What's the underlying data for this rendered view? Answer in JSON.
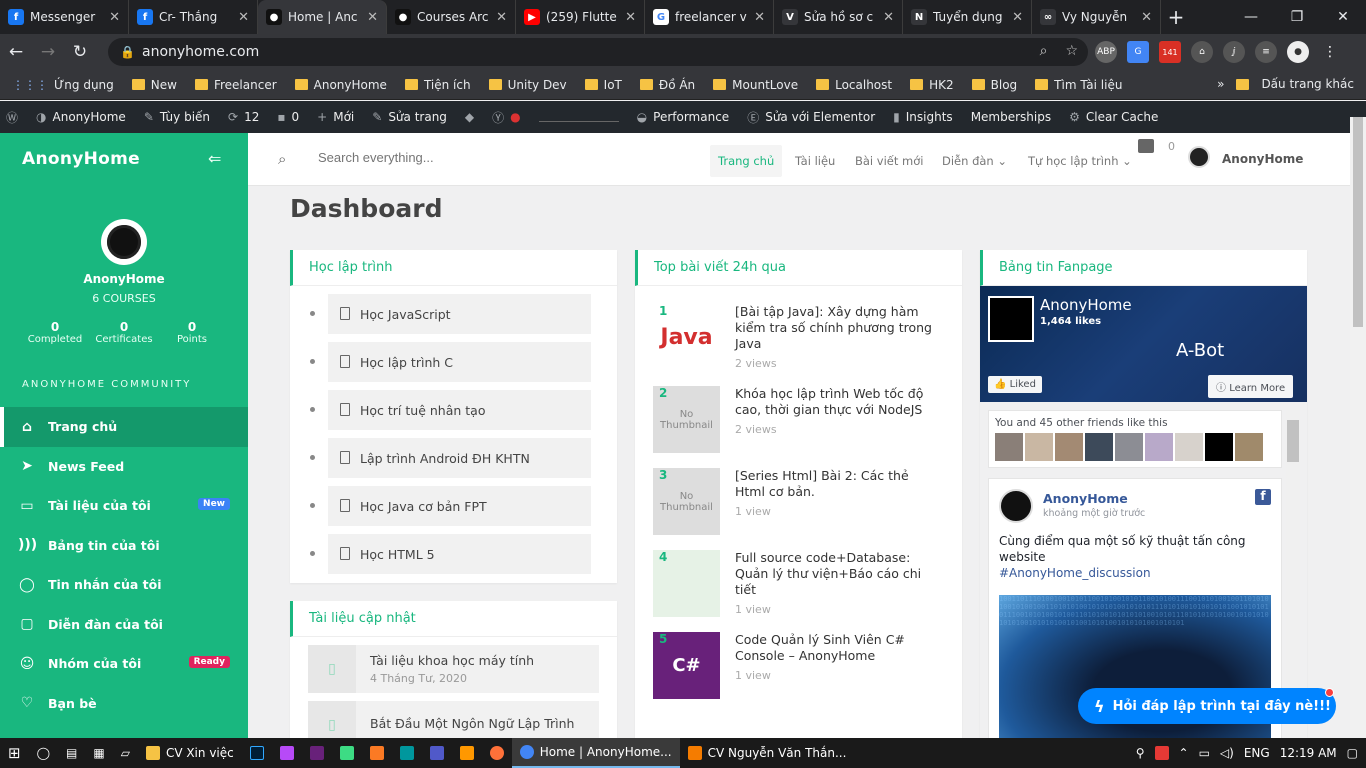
{
  "browser": {
    "tabs": [
      {
        "title": "Messenger",
        "icon": "facebook-icon",
        "color": "#1877f2",
        "glyph": "f"
      },
      {
        "title": "Cr- Thắng",
        "icon": "facebook-icon",
        "color": "#1877f2",
        "glyph": "f"
      },
      {
        "title": "Home | Anc",
        "icon": "anonyhome-icon",
        "color": "#111111",
        "glyph": "●",
        "active": true
      },
      {
        "title": "Courses Arc",
        "icon": "anonyhome-icon",
        "color": "#111111",
        "glyph": "●"
      },
      {
        "title": "(259) Flutte",
        "icon": "youtube-icon",
        "color": "#ff0000",
        "glyph": "▶"
      },
      {
        "title": "freelancer v",
        "icon": "google-icon",
        "color": "#ffffff",
        "glyph": "G"
      },
      {
        "title": "Sửa hồ sơ c",
        "icon": "vietnamworks-icon",
        "color": "#35363a",
        "glyph": "V"
      },
      {
        "title": "Tuyển dụng",
        "icon": "topcv-icon",
        "color": "#35363a",
        "glyph": "N"
      },
      {
        "title": "Vy Nguyễn",
        "icon": "mask-icon",
        "color": "#35363a",
        "glyph": "∞"
      }
    ],
    "url": "anonyhome.com",
    "bookmarks": [
      "Ứng dụng",
      "New",
      "Freelancer",
      "AnonyHome",
      "Tiện ích",
      "Unity Dev",
      "IoT",
      "Đồ Án",
      "MountLove",
      "Localhost",
      "HK2",
      "Blog",
      "Tìm Tài liệu"
    ],
    "bookmarks_overflow": "»",
    "other_bookmarks": "Dấu trang khác",
    "ext_badge": "141"
  },
  "wp_admin_bar": {
    "site": "AnonyHome",
    "customize": "Tùy biến",
    "updates": "12",
    "comments": "0",
    "new": "Mới",
    "edit": "Sửa trang",
    "performance": "Performance",
    "elementor": "Sửa với Elementor",
    "insights": "Insights",
    "memberships": "Memberships",
    "clear_cache": "Clear Cache"
  },
  "sidebar": {
    "logo": "AnonyHome",
    "user_name": "AnonyHome",
    "courses": "6 COURSES",
    "stats": [
      {
        "value": "0",
        "label": "Completed"
      },
      {
        "value": "0",
        "label": "Certificates"
      },
      {
        "value": "0",
        "label": "Points"
      }
    ],
    "community_title": "ANONYHOME COMMUNITY",
    "items": [
      {
        "label": "Trang chủ",
        "icon": "home-icon",
        "glyph": "⌂",
        "active": true
      },
      {
        "label": "News Feed",
        "icon": "send-icon",
        "glyph": "➤"
      },
      {
        "label": "Tài liệu của tôi",
        "icon": "folder-icon",
        "glyph": "▭",
        "badge": "New",
        "badge_color": "#3b82f6"
      },
      {
        "label": "Bảng tin của tôi",
        "icon": "rss-icon",
        "glyph": ")))"
      },
      {
        "label": "Tin nhắn của tôi",
        "icon": "chat-icon",
        "glyph": "◯"
      },
      {
        "label": "Diễn đàn của tôi",
        "icon": "forum-icon",
        "glyph": "▢"
      },
      {
        "label": "Nhóm của tôi",
        "icon": "group-icon",
        "glyph": "☺",
        "badge": "Ready",
        "badge_color": "#e0245e"
      },
      {
        "label": "Bạn bè",
        "icon": "heart-icon",
        "glyph": "♡"
      }
    ]
  },
  "topnav": {
    "search_placeholder": "Search everything...",
    "links": [
      "Trang chủ",
      "Tài liệu",
      "Bài viết mới",
      "Diễn đàn ⌄",
      "Tự học lập trình ⌄"
    ],
    "notif_count": "0",
    "user": "AnonyHome"
  },
  "dashboard": {
    "title": "Dashboard",
    "courses_card": {
      "title": "Học lập trình",
      "items": [
        "Học JavaScript",
        "Học lập trình C",
        "Học trí tuệ nhân tạo",
        "Lập trình Android ĐH KHTN",
        "Học Java cơ bản FPT",
        "Học HTML 5"
      ]
    },
    "docs_card": {
      "title": "Tài liệu cập nhật",
      "items": [
        {
          "title": "Tài liệu khoa học máy tính",
          "date": "4 Tháng Tư, 2020"
        },
        {
          "title": "Bắt Đầu Một Ngôn Ngữ Lập Trình",
          "date": ""
        }
      ]
    },
    "top_card": {
      "title": "Top bài viết 24h qua",
      "posts": [
        {
          "rank": "1",
          "title": "[Bài tập Java]: Xây dựng hàm kiểm tra số chính phương trong Java",
          "views": "2 views",
          "thumb": "Java"
        },
        {
          "rank": "2",
          "title": "Khóa học lập trình Web tốc độ cao, thời gian thực với NodeJS",
          "views": "2 views",
          "thumb": "No Thumbnail"
        },
        {
          "rank": "3",
          "title": "[Series Html] Bài 2: Các thẻ Html cơ bản.",
          "views": "1 view",
          "thumb": "No Thumbnail"
        },
        {
          "rank": "4",
          "title": "Full source code+Database: Quản lý thư viện+Báo cáo chi tiết",
          "views": "1 view",
          "thumb": ""
        },
        {
          "rank": "5",
          "title": "Code Quản lý Sinh Viên C# Console – AnonyHome",
          "views": "1 view",
          "thumb": "C#"
        }
      ]
    },
    "fanpage_card": {
      "title": "Bảng tin Fanpage",
      "page_name": "AnonyHome",
      "likes": "1,464 likes",
      "cover_text": "A-Bot",
      "liked_label": "Liked",
      "learn_more": "Learn More",
      "friends_text": "You and 45 other friends like this",
      "post_author": "AnonyHome",
      "post_time": "khoảng một giờ trước",
      "post_text": "Cùng điểm qua một số kỹ thuật tấn công website",
      "post_tag": "#AnonyHome_discussion"
    }
  },
  "messenger_widget": {
    "label": "Hỏi đáp lập trình tại đây nè!!!"
  },
  "taskbar": {
    "windows": [
      {
        "label": "CV Xin việc",
        "color": "#f6c344"
      },
      {
        "label": "Home | AnonyHome...",
        "color": "#4285f4",
        "active": true
      },
      {
        "label": "CV Nguyễn Văn Thắn...",
        "color": "#f57c00"
      }
    ],
    "lang": "ENG",
    "time": "12:19 AM"
  }
}
